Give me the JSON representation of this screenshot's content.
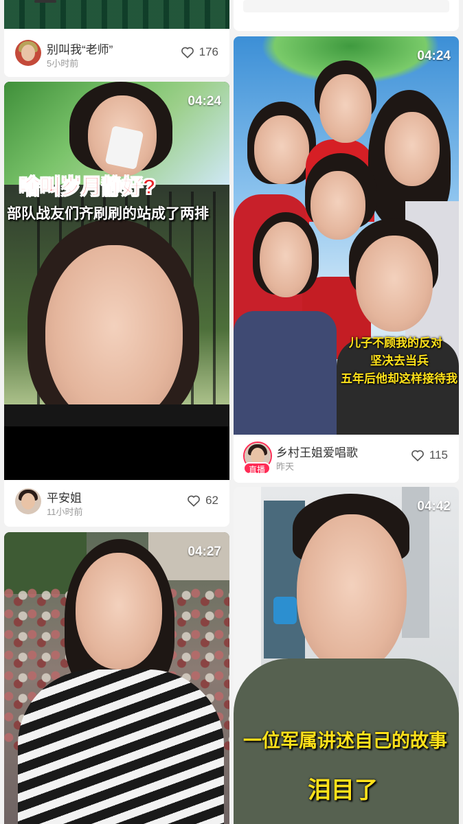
{
  "left_column": {
    "card1": {
      "author": "别叫我“老师”",
      "time": "5小时前",
      "likes": "176"
    },
    "card2": {
      "duration": "04:24",
      "title": "啥叫岁月静好?",
      "subtitle": "部队战友们齐刷刷的站成了两排",
      "author": "平安姐",
      "time": "11小时前",
      "likes": "62"
    },
    "card3": {
      "duration": "04:27"
    }
  },
  "right_column": {
    "card1": {
      "duration": "04:24",
      "caption_lines": [
        "儿子不顾我的反对",
        "坚决去当兵",
        "五年后他却这样接待我"
      ],
      "author": "乡村王姐爱唱歌",
      "live_label": "直播",
      "time": "昨天",
      "likes": "115"
    },
    "card2": {
      "duration": "04:42",
      "caption_line1": "一位军属讲述自己的故事",
      "caption_line2": "泪目了"
    }
  },
  "colors": {
    "live": "#fe2c55",
    "caption_yellow": "#ffe11a",
    "red_title": "#e8262a"
  }
}
